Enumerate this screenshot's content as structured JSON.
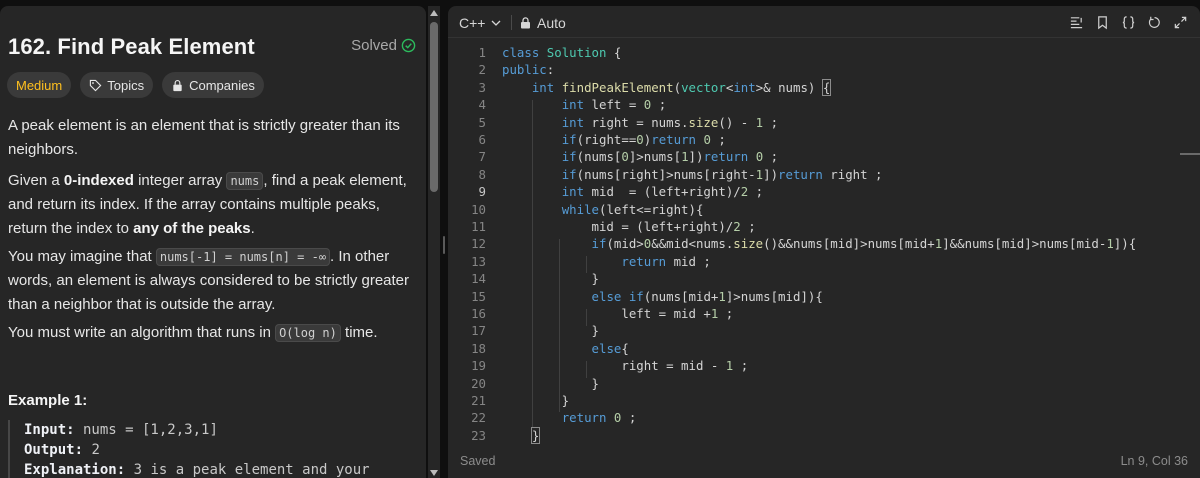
{
  "problem": {
    "title": "162. Find Peak Element",
    "status": "Solved",
    "difficulty": "Medium",
    "topics_label": "Topics",
    "companies_label": "Companies",
    "p1": "A peak element is an element that is strictly greater than its neighbors.",
    "p2_a": "Given a ",
    "p2_b": "0-indexed",
    "p2_c": " integer array ",
    "p2_code": "nums",
    "p2_d": ", find a peak element, and return its index. If the array contains multiple peaks, return the index to ",
    "p2_e": "any of the peaks",
    "p2_f": ".",
    "p3_a": "You may imagine that ",
    "p3_code": "nums[-1] = nums[n] = -∞",
    "p3_b": ". In other words, an element is always considered to be strictly greater than a neighbor that is outside the array.",
    "p4_a": "You must write an algorithm that runs in ",
    "p4_code": "O(log n)",
    "p4_b": " time.",
    "example_title": "Example 1:",
    "ex_input_label": "Input:",
    "ex_input_value": " nums = [1,2,3,1]",
    "ex_output_label": "Output:",
    "ex_output_value": " 2",
    "ex_expl_label": "Explanation:",
    "ex_expl_value": " 3 is a peak element and your"
  },
  "editor": {
    "language": "C++",
    "mode": "Auto",
    "save_status": "Saved",
    "cursor_position": "Ln 9, Col 36",
    "current_line": 9,
    "lines": [
      "1",
      "2",
      "3",
      "4",
      "5",
      "6",
      "7",
      "8",
      "9",
      "10",
      "11",
      "12",
      "13",
      "14",
      "15",
      "16",
      "17",
      "18",
      "19",
      "20",
      "21",
      "22",
      "23"
    ]
  },
  "icons": {
    "solved": "check-circle-icon",
    "topics": "tag-icon",
    "companies": "lock-icon",
    "mode": "lock-icon",
    "language_dropdown": "chevron-down-icon",
    "tools": [
      "format-icon",
      "bookmark-icon",
      "braces-icon",
      "reset-icon",
      "expand-icon"
    ]
  },
  "colors": {
    "medium": "#ffc01e",
    "solved": "#2cbb5d",
    "keyword": "#569cd6",
    "function": "#dcdcaa",
    "type": "#4ec9b0",
    "number": "#b5cea8"
  }
}
